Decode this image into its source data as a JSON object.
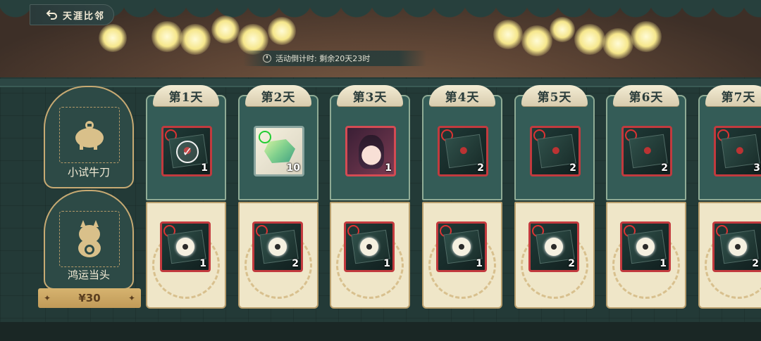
{
  "header": {
    "back_label": "天涯比邻"
  },
  "event": {
    "countdown": "活动倒计时:  剩余20天23时"
  },
  "tiers": [
    {
      "label": "小试牛刀",
      "icon": "piggy-bank-icon"
    },
    {
      "label": "鸿运当头",
      "icon": "lucky-cat-icon"
    }
  ],
  "price": "¥30",
  "days": [
    {
      "label": "第1天",
      "top": {
        "icon": "claimed-check-icon",
        "qty": "1"
      },
      "bottom": {
        "icon": "locked-chest-icon",
        "qty": "1"
      }
    },
    {
      "label": "第2天",
      "top": {
        "icon": "jade-gem-icon",
        "qty": "10"
      },
      "bottom": {
        "icon": "locked-chest-icon",
        "qty": "2"
      }
    },
    {
      "label": "第3天",
      "top": {
        "icon": "character-portrait-icon",
        "qty": "1"
      },
      "bottom": {
        "icon": "locked-chest-icon",
        "qty": "1"
      }
    },
    {
      "label": "第4天",
      "top": {
        "icon": "chest-icon",
        "qty": "2"
      },
      "bottom": {
        "icon": "locked-chest-icon",
        "qty": "1"
      }
    },
    {
      "label": "第5天",
      "top": {
        "icon": "chest-icon",
        "qty": "2"
      },
      "bottom": {
        "icon": "locked-chest-icon",
        "qty": "2"
      }
    },
    {
      "label": "第6天",
      "top": {
        "icon": "chest-icon",
        "qty": "2"
      },
      "bottom": {
        "icon": "locked-chest-icon",
        "qty": "1"
      }
    },
    {
      "label": "第7天",
      "top": {
        "icon": "chest-icon",
        "qty": "3"
      },
      "bottom": {
        "icon": "locked-chest-icon",
        "qty": "2"
      }
    }
  ],
  "colors": {
    "accent_gold": "#c7aa73",
    "frame_red": "#c23a3e",
    "panel_green": "#345c57"
  }
}
